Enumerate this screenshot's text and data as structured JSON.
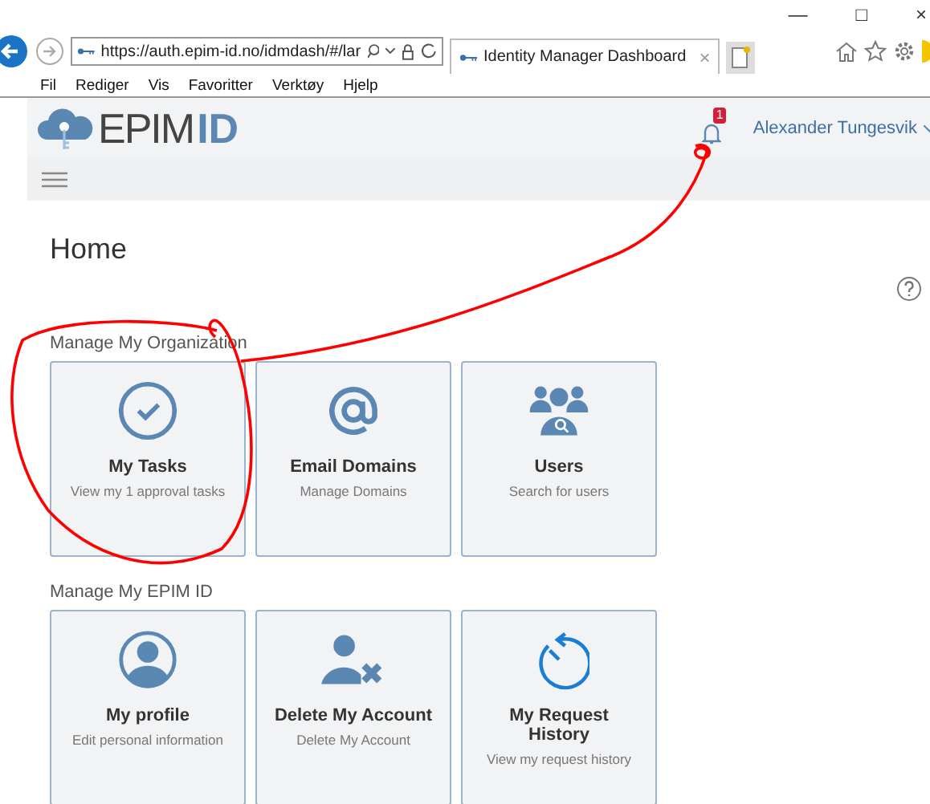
{
  "browser": {
    "window_controls": [
      "—",
      "□",
      "×"
    ],
    "address": "https://auth.epim-id.no/idmdash/#/lar",
    "tab": {
      "title": "Identity Manager Dashboard",
      "close": "×"
    },
    "menu": [
      "Fil",
      "Rediger",
      "Vis",
      "Favoritter",
      "Verktøy",
      "Hjelp"
    ]
  },
  "header": {
    "logo": {
      "part1": "EPIM",
      "part2": "ID"
    },
    "notifications": "1",
    "user": "Alexander Tungesvik"
  },
  "page": {
    "title": "Home"
  },
  "sections": [
    {
      "title": "Manage My Organization",
      "tiles": [
        {
          "kind": "tasks",
          "title": "My Tasks",
          "subtitle": "View my 1 approval tasks"
        },
        {
          "kind": "email",
          "title": "Email Domains",
          "subtitle": "Manage Domains"
        },
        {
          "kind": "users",
          "title": "Users",
          "subtitle": "Search for users"
        }
      ]
    },
    {
      "title": "Manage My EPIM ID",
      "tiles": [
        {
          "kind": "profile",
          "title": "My profile",
          "subtitle": "Edit personal information"
        },
        {
          "kind": "delete",
          "title": "Delete My Account",
          "subtitle": "Delete My Account"
        },
        {
          "kind": "history",
          "title": "My Request History",
          "subtitle": "View my request history"
        }
      ]
    }
  ]
}
